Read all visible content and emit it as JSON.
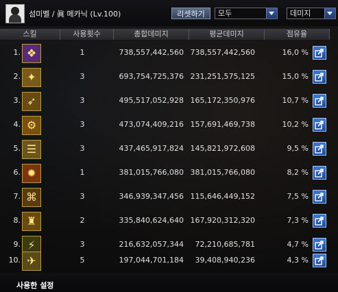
{
  "header": {
    "title": "섬미벨 / 眞 메카닉 (Lv.100)",
    "reset_label": "리셋하기",
    "filter_value": "모두",
    "sort_value": "데미지"
  },
  "columns": [
    "스킬",
    "사용횟수",
    "총합데미지",
    "평균데미지",
    "점유율"
  ],
  "rows": [
    {
      "rank": "1.",
      "icon": "mech-skill-1-icon",
      "glyph": "❖",
      "bg": "#5a2a7a",
      "count": "1",
      "total": "738,557,442,560",
      "avg": "738,557,442,560",
      "share": "16,0 %"
    },
    {
      "rank": "2.",
      "icon": "mech-skill-2-icon",
      "glyph": "✦",
      "bg": "#7a5a1a",
      "count": "3",
      "total": "693,754,725,376",
      "avg": "231,251,575,125",
      "share": "15,0 %"
    },
    {
      "rank": "3.",
      "icon": "mech-skill-3-icon",
      "glyph": "➶",
      "bg": "#6a4a14",
      "count": "3",
      "total": "495,517,052,928",
      "avg": "165,172,350,976",
      "share": "10,7 %"
    },
    {
      "rank": "4.",
      "icon": "mech-skill-4-icon",
      "glyph": "⚙",
      "bg": "#7a5010",
      "count": "3",
      "total": "473,074,409,216",
      "avg": "157,691,469,738",
      "share": "10,2 %"
    },
    {
      "rank": "5.",
      "icon": "mech-skill-5-icon",
      "glyph": "☰",
      "bg": "#6a5420",
      "count": "3",
      "total": "437,465,917,824",
      "avg": "145,821,972,608",
      "share": "9,5 %"
    },
    {
      "rank": "6.",
      "icon": "mech-skill-6-icon",
      "glyph": "✹",
      "bg": "#7a3410",
      "count": "1",
      "total": "381,015,766,080",
      "avg": "381,015,766,080",
      "share": "8,2 %"
    },
    {
      "rank": "7.",
      "icon": "mech-skill-7-icon",
      "glyph": "⌘",
      "bg": "#5a3a14",
      "count": "3",
      "total": "346,939,347,456",
      "avg": "115,646,449,152",
      "share": "7,5 %"
    },
    {
      "rank": "8.",
      "icon": "mech-skill-8-icon",
      "glyph": "♜",
      "bg": "#6a4a10",
      "count": "2",
      "total": "335,840,624,640",
      "avg": "167,920,312,320",
      "share": "7,3 %"
    },
    {
      "rank": "9.",
      "icon": "mech-skill-9-icon",
      "glyph": "⚡",
      "bg": "#3a3a14",
      "count": "3",
      "total": "216,632,057,344",
      "avg": "72,210,685,781",
      "share": "4,7 %"
    },
    {
      "rank": "10.",
      "icon": "mech-skill-10-icon",
      "glyph": "✈",
      "bg": "#5a4a18",
      "count": "5",
      "total": "197,044,701,184",
      "avg": "39,408,940,236",
      "share": "4,3 %"
    }
  ],
  "footer": {
    "label": "사용한 설정"
  },
  "colors": {
    "accent_button": "#2a5cb0",
    "icon_border": "#b89a40"
  }
}
